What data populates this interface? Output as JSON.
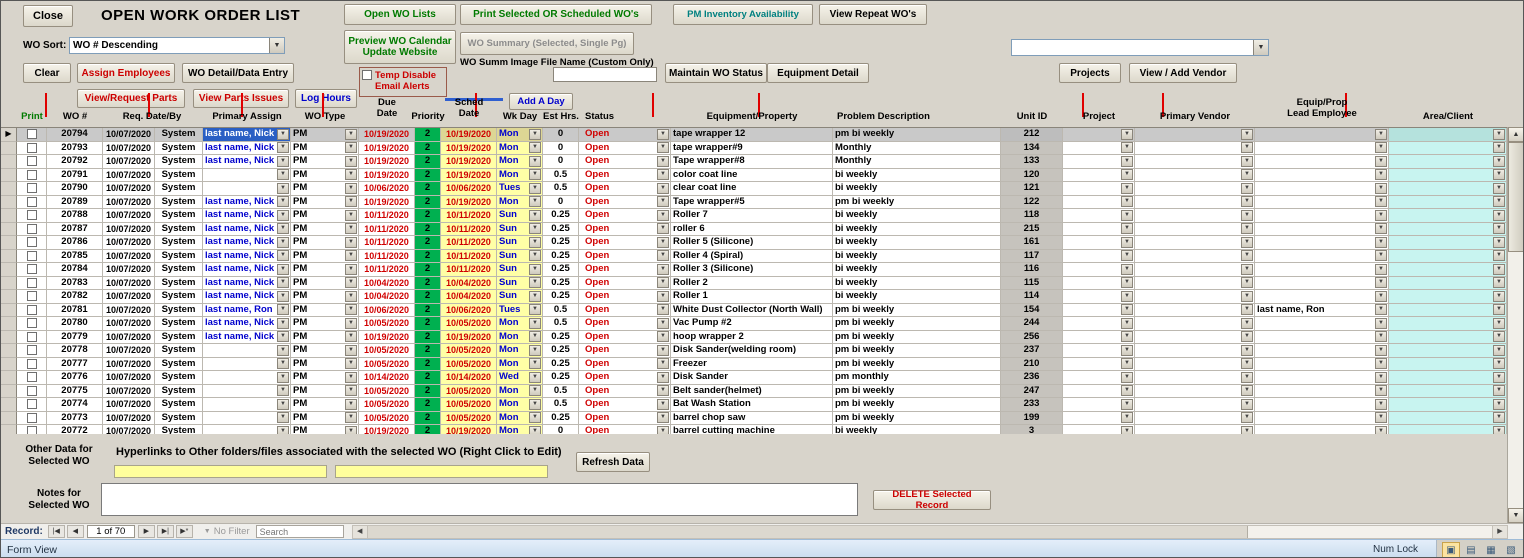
{
  "window": {
    "form_view": "Form View",
    "num_lock": "Num Lock"
  },
  "colors": {
    "button_green": "#007a00",
    "button_teal": "#008080",
    "button_red": "#cc0000",
    "button_blue": "#0000cc",
    "priority_green": "#00b050",
    "date_red": "#d00000",
    "sched_yellow": "#ffffa6",
    "area_cyan": "#c8f4f0",
    "selection_blue": "#2a5fc4",
    "unit_gray": "#c6c3bd"
  },
  "icons": {
    "dropdown": "▼",
    "row_marker": "▶",
    "first": "|◀",
    "previous": "◀",
    "next": "▶",
    "last": "▶|",
    "new_record": "▶*",
    "filter": "▼",
    "scroll_up": "▲",
    "scroll_down": "▼",
    "scroll_left": "◀",
    "scroll_right": "▶",
    "view_buttons": [
      "▣",
      "▤",
      "▦",
      "▧"
    ]
  },
  "header": {
    "close": "Close",
    "title": "OPEN WORK ORDER LIST",
    "open_wo_lists": "Open WO Lists",
    "print_selected": "Print Selected OR Scheduled WO's",
    "pm_inventory": "PM Inventory Availability",
    "view_repeat": "View Repeat WO's",
    "wo_sort_label": "WO Sort:",
    "wo_sort_value": "WO # Descending",
    "preview_calendar": "Preview WO Calendar\nUpdate Website",
    "wo_summary": "WO Summary (Selected, Single Pg)",
    "clear": "Clear",
    "assign_employees": "Assign Employees",
    "wo_detail": "WO Detail/Data Entry",
    "temp_disable": "Temp Disable\nEmail Alerts",
    "wo_summ_label": "WO Summ Image File Name (Custom Only)",
    "maintain_status": "Maintain WO Status",
    "equipment_detail": "Equipment Detail",
    "projects": "Projects",
    "view_add_vendor": "View / Add Vendor",
    "view_request_parts": "View/Request Parts",
    "view_parts_issues": "View Parts Issues",
    "log_hours": "Log Hours",
    "add_a_day": "Add A Day"
  },
  "table": {
    "headers": {
      "print": "Print",
      "wo": "WO #",
      "req": "Req. Date/By",
      "assign": "Primary Assign",
      "type": "WO Type",
      "due": "Due\nDate",
      "priority": "Priority",
      "sched": "Sched\nDate",
      "wkday": "Wk Day",
      "est": "Est Hrs.",
      "status": "Status",
      "equipment": "Equipment/Property",
      "problem": "Problem Description",
      "unit": "Unit ID",
      "project": "Project",
      "vendor": "Primary Vendor",
      "lead": "Equip/Prop\nLead Employee",
      "area": "Area/Client"
    },
    "rows": [
      {
        "selected": true,
        "wo": "20794",
        "req_date": "10/07/2020",
        "req_by": "System",
        "assign": "last name, Nick",
        "type": "PM",
        "due": "10/19/2020",
        "priority": "2",
        "sched": "10/19/2020",
        "wkday": "Mon",
        "est": "0",
        "status": "Open",
        "equipment": "tape wrapper 12",
        "problem": "pm bi weekly",
        "unit": "212",
        "project": "",
        "vendor": "",
        "lead": "",
        "area": ""
      },
      {
        "wo": "20793",
        "req_date": "10/07/2020",
        "req_by": "System",
        "assign": "last name, Nick",
        "type": "PM",
        "due": "10/19/2020",
        "priority": "2",
        "sched": "10/19/2020",
        "wkday": "Mon",
        "est": "0",
        "status": "Open",
        "equipment": "tape wrapper#9",
        "problem": "Monthly",
        "unit": "134",
        "project": "",
        "vendor": "",
        "lead": "",
        "area": ""
      },
      {
        "wo": "20792",
        "req_date": "10/07/2020",
        "req_by": "System",
        "assign": "last name, Nick",
        "type": "PM",
        "due": "10/19/2020",
        "priority": "2",
        "sched": "10/19/2020",
        "wkday": "Mon",
        "est": "0",
        "status": "Open",
        "equipment": "Tape wrapper#8",
        "problem": "Monthly",
        "unit": "133",
        "project": "",
        "vendor": "",
        "lead": "",
        "area": ""
      },
      {
        "wo": "20791",
        "req_date": "10/07/2020",
        "req_by": "System",
        "assign": "",
        "type": "PM",
        "due": "10/19/2020",
        "priority": "2",
        "sched": "10/19/2020",
        "wkday": "Mon",
        "est": "0.5",
        "status": "Open",
        "equipment": "color  coat line",
        "problem": "bi weekly",
        "unit": "120",
        "project": "",
        "vendor": "",
        "lead": "",
        "area": ""
      },
      {
        "wo": "20790",
        "req_date": "10/07/2020",
        "req_by": "System",
        "assign": "",
        "type": "PM",
        "due": "10/06/2020",
        "priority": "2",
        "sched": "10/06/2020",
        "wkday": "Tues",
        "est": "0.5",
        "status": "Open",
        "equipment": "clear coat line",
        "problem": "bi weekly",
        "unit": "121",
        "project": "",
        "vendor": "",
        "lead": "",
        "area": ""
      },
      {
        "wo": "20789",
        "req_date": "10/07/2020",
        "req_by": "System",
        "assign": "last name, Nick",
        "type": "PM",
        "due": "10/19/2020",
        "priority": "2",
        "sched": "10/19/2020",
        "wkday": "Mon",
        "est": "0",
        "status": "Open",
        "equipment": "Tape wrapper#5",
        "problem": "pm bi weekly",
        "unit": "122",
        "project": "",
        "vendor": "",
        "lead": "",
        "area": ""
      },
      {
        "wo": "20788",
        "req_date": "10/07/2020",
        "req_by": "System",
        "assign": "last name, Nick",
        "type": "PM",
        "due": "10/11/2020",
        "priority": "2",
        "sched": "10/11/2020",
        "wkday": "Sun",
        "est": "0.25",
        "status": "Open",
        "equipment": "Roller 7",
        "problem": "bi weekly",
        "unit": "118",
        "project": "",
        "vendor": "",
        "lead": "",
        "area": ""
      },
      {
        "wo": "20787",
        "req_date": "10/07/2020",
        "req_by": "System",
        "assign": "last name, Nick",
        "type": "PM",
        "due": "10/11/2020",
        "priority": "2",
        "sched": "10/11/2020",
        "wkday": "Sun",
        "est": "0.25",
        "status": "Open",
        "equipment": "roller 6",
        "problem": "bi weekly",
        "unit": "215",
        "project": "",
        "vendor": "",
        "lead": "",
        "area": ""
      },
      {
        "wo": "20786",
        "req_date": "10/07/2020",
        "req_by": "System",
        "assign": "last name, Nick",
        "type": "PM",
        "due": "10/11/2020",
        "priority": "2",
        "sched": "10/11/2020",
        "wkday": "Sun",
        "est": "0.25",
        "status": "Open",
        "equipment": "Roller 5 (Silicone)",
        "problem": "bi weekly",
        "unit": "161",
        "project": "",
        "vendor": "",
        "lead": "",
        "area": ""
      },
      {
        "wo": "20785",
        "req_date": "10/07/2020",
        "req_by": "System",
        "assign": "last name, Nick",
        "type": "PM",
        "due": "10/11/2020",
        "priority": "2",
        "sched": "10/11/2020",
        "wkday": "Sun",
        "est": "0.25",
        "status": "Open",
        "equipment": "Roller 4 (Spiral)",
        "problem": "bi weekly",
        "unit": "117",
        "project": "",
        "vendor": "",
        "lead": "",
        "area": ""
      },
      {
        "wo": "20784",
        "req_date": "10/07/2020",
        "req_by": "System",
        "assign": "last name, Nick",
        "type": "PM",
        "due": "10/11/2020",
        "priority": "2",
        "sched": "10/11/2020",
        "wkday": "Sun",
        "est": "0.25",
        "status": "Open",
        "equipment": "Roller 3 (Silicone)",
        "problem": "bi weekly",
        "unit": "116",
        "project": "",
        "vendor": "",
        "lead": "",
        "area": ""
      },
      {
        "wo": "20783",
        "req_date": "10/07/2020",
        "req_by": "System",
        "assign": "last name, Nick",
        "type": "PM",
        "due": "10/04/2020",
        "priority": "2",
        "sched": "10/04/2020",
        "wkday": "Sun",
        "est": "0.25",
        "status": "Open",
        "equipment": "Roller 2",
        "problem": "bi weekly",
        "unit": "115",
        "project": "",
        "vendor": "",
        "lead": "",
        "area": ""
      },
      {
        "wo": "20782",
        "req_date": "10/07/2020",
        "req_by": "System",
        "assign": "last name, Nick",
        "type": "PM",
        "due": "10/04/2020",
        "priority": "2",
        "sched": "10/04/2020",
        "wkday": "Sun",
        "est": "0.25",
        "status": "Open",
        "equipment": "Roller 1",
        "problem": "bi weekly",
        "unit": "114",
        "project": "",
        "vendor": "",
        "lead": "",
        "area": ""
      },
      {
        "wo": "20781",
        "req_date": "10/07/2020",
        "req_by": "System",
        "assign": "last name, Ron",
        "type": "PM",
        "due": "10/06/2020",
        "priority": "2",
        "sched": "10/06/2020",
        "wkday": "Tues",
        "est": "0.5",
        "status": "Open",
        "equipment": "White Dust Collector (North Wall)",
        "problem": "pm bi weekly",
        "unit": "154",
        "project": "",
        "vendor": "",
        "lead": "last name, Ron",
        "area": ""
      },
      {
        "wo": "20780",
        "req_date": "10/07/2020",
        "req_by": "System",
        "assign": "last name, Nick",
        "type": "PM",
        "due": "10/05/2020",
        "priority": "2",
        "sched": "10/05/2020",
        "wkday": "Mon",
        "est": "0.5",
        "status": "Open",
        "equipment": "Vac Pump #2",
        "problem": "pm bi weekly",
        "unit": "244",
        "project": "",
        "vendor": "",
        "lead": "",
        "area": ""
      },
      {
        "wo": "20779",
        "req_date": "10/07/2020",
        "req_by": "System",
        "assign": "last name, Nick",
        "type": "PM",
        "due": "10/19/2020",
        "priority": "2",
        "sched": "10/19/2020",
        "wkday": "Mon",
        "est": "0.25",
        "status": "Open",
        "equipment": "hoop wrapper 2",
        "problem": "pm bi weekly",
        "unit": "256",
        "project": "",
        "vendor": "",
        "lead": "",
        "area": ""
      },
      {
        "wo": "20778",
        "req_date": "10/07/2020",
        "req_by": "System",
        "assign": "",
        "type": "PM",
        "due": "10/05/2020",
        "priority": "2",
        "sched": "10/05/2020",
        "wkday": "Mon",
        "est": "0.25",
        "status": "Open",
        "equipment": "Disk Sander(welding room)",
        "problem": "pm bi weekly",
        "unit": "237",
        "project": "",
        "vendor": "",
        "lead": "",
        "area": ""
      },
      {
        "wo": "20777",
        "req_date": "10/07/2020",
        "req_by": "System",
        "assign": "",
        "type": "PM",
        "due": "10/05/2020",
        "priority": "2",
        "sched": "10/05/2020",
        "wkday": "Mon",
        "est": "0.25",
        "status": "Open",
        "equipment": "Freezer",
        "problem": "pm bi weekly",
        "unit": "210",
        "project": "",
        "vendor": "",
        "lead": "",
        "area": ""
      },
      {
        "wo": "20776",
        "req_date": "10/07/2020",
        "req_by": "System",
        "assign": "",
        "type": "PM",
        "due": "10/14/2020",
        "priority": "2",
        "sched": "10/14/2020",
        "wkday": "Wed",
        "est": "0.25",
        "status": "Open",
        "equipment": "Disk Sander",
        "problem": "pm monthly",
        "unit": "236",
        "project": "",
        "vendor": "",
        "lead": "",
        "area": ""
      },
      {
        "wo": "20775",
        "req_date": "10/07/2020",
        "req_by": "System",
        "assign": "",
        "type": "PM",
        "due": "10/05/2020",
        "priority": "2",
        "sched": "10/05/2020",
        "wkday": "Mon",
        "est": "0.5",
        "status": "Open",
        "equipment": "Belt sander(helmet)",
        "problem": "pm bi weekly",
        "unit": "247",
        "project": "",
        "vendor": "",
        "lead": "",
        "area": ""
      },
      {
        "wo": "20774",
        "req_date": "10/07/2020",
        "req_by": "System",
        "assign": "",
        "type": "PM",
        "due": "10/05/2020",
        "priority": "2",
        "sched": "10/05/2020",
        "wkday": "Mon",
        "est": "0.5",
        "status": "Open",
        "equipment": "Bat Wash Station",
        "problem": "pm bi weekly",
        "unit": "233",
        "project": "",
        "vendor": "",
        "lead": "",
        "area": ""
      },
      {
        "wo": "20773",
        "req_date": "10/07/2020",
        "req_by": "System",
        "assign": "",
        "type": "PM",
        "due": "10/05/2020",
        "priority": "2",
        "sched": "10/05/2020",
        "wkday": "Mon",
        "est": "0.25",
        "status": "Open",
        "equipment": "barrel chop saw",
        "problem": "pm bi weekly",
        "unit": "199",
        "project": "",
        "vendor": "",
        "lead": "",
        "area": ""
      },
      {
        "wo": "20772",
        "req_date": "10/07/2020",
        "req_by": "System",
        "assign": "",
        "type": "PM",
        "due": "10/19/2020",
        "priority": "2",
        "sched": "10/19/2020",
        "wkday": "Mon",
        "est": "0",
        "status": "Open",
        "equipment": "barrel cutting machine",
        "problem": "bi weekly",
        "unit": "3",
        "project": "",
        "vendor": "",
        "lead": "",
        "area": ""
      }
    ]
  },
  "footer": {
    "other_data_label": "Other Data for\nSelected WO",
    "hyperlinks_label": "Hyperlinks to Other folders/files associated with the selected WO (Right Click to Edit)",
    "refresh": "Refresh Data",
    "notes_label": "Notes for\nSelected WO",
    "delete": "DELETE Selected Record"
  },
  "recordbar": {
    "label": "Record:",
    "position": "1 of 70",
    "no_filter": "No Filter",
    "search": "Search"
  }
}
